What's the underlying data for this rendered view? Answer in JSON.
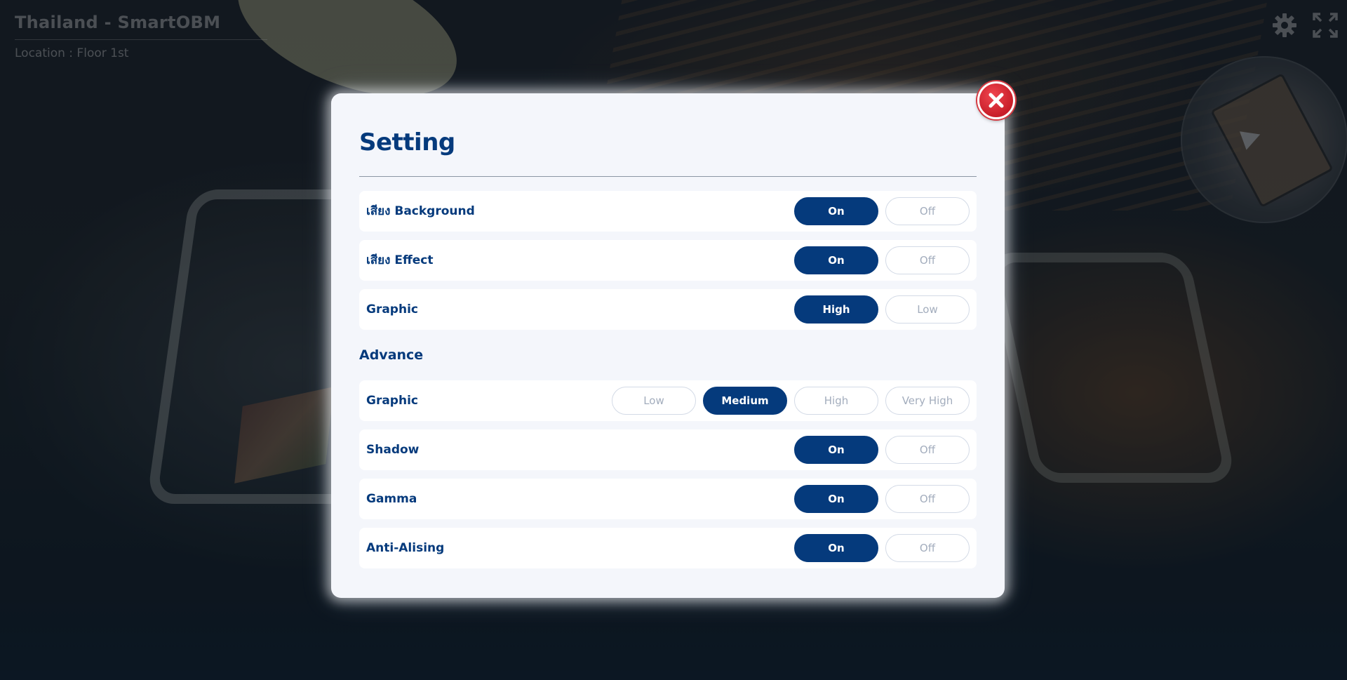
{
  "header": {
    "title": "Thailand - SmartOBM",
    "location": "Location : Floor 1st"
  },
  "icons": {
    "settings": "gear-icon",
    "fullscreen": "fullscreen-icon",
    "close": "close-icon"
  },
  "modal": {
    "title": "Setting",
    "rows": [
      {
        "label": "เสียง Background",
        "options": [
          "On",
          "Off"
        ],
        "selected": "On"
      },
      {
        "label": "เสียง Effect",
        "options": [
          "On",
          "Off"
        ],
        "selected": "On"
      },
      {
        "label": "Graphic",
        "options": [
          "High",
          "Low"
        ],
        "selected": "High"
      }
    ],
    "advance": {
      "title": "Advance",
      "graphic": {
        "label": "Graphic",
        "options": [
          "Low",
          "Medium",
          "High",
          "Very High"
        ],
        "selected": "Medium"
      },
      "rows": [
        {
          "label": "Shadow",
          "options": [
            "On",
            "Off"
          ],
          "selected": "On"
        },
        {
          "label": "Gamma",
          "options": [
            "On",
            "Off"
          ],
          "selected": "On"
        },
        {
          "label": "Anti-Alising",
          "options": [
            "On",
            "Off"
          ],
          "selected": "On"
        }
      ]
    }
  },
  "colors": {
    "primary": "#053a7c",
    "close": "#e0313b",
    "panel": "#f4f6fb"
  }
}
